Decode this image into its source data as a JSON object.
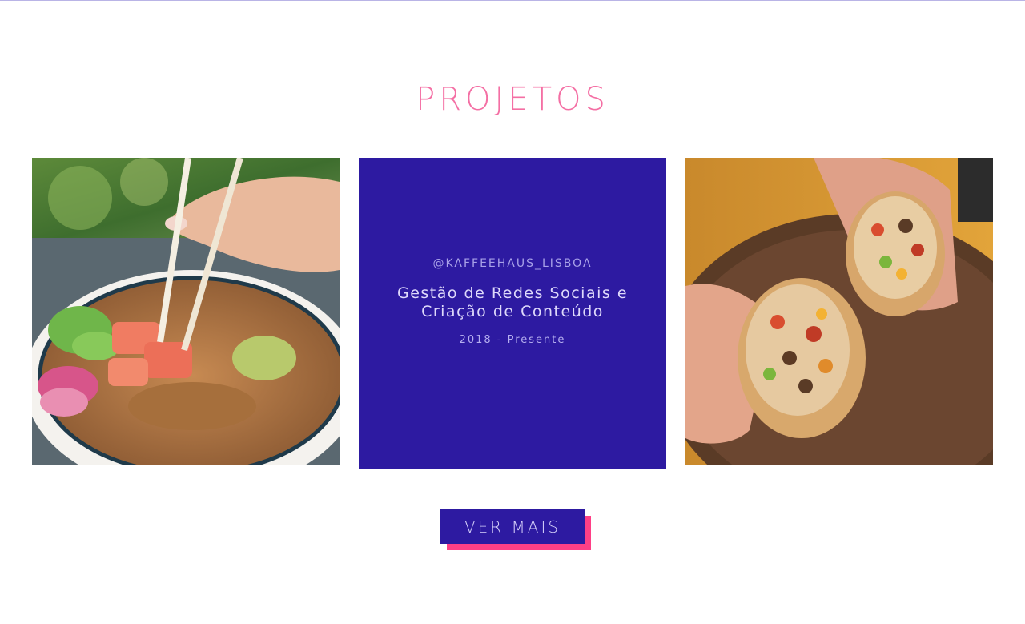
{
  "section": {
    "title": "PROJETOS"
  },
  "projects": [
    {
      "image": "poke-bowl-photo",
      "alt": "Poke bowl with salmon and chopsticks"
    },
    {
      "handle": "@KAFFEEHAUS_LISBOA",
      "service": "Gestão de Redes Sociais e Criação de Conteúdo",
      "period": "2018 - Presente",
      "background": "#2d1aa1"
    },
    {
      "image": "burrito-photo",
      "alt": "Hands holding a cut burrito"
    }
  ],
  "cta": {
    "label": "VER MAIS",
    "color": "#2d1aa1",
    "shadow_color": "#ff3f86"
  },
  "colors": {
    "title": "#f46fa4"
  }
}
